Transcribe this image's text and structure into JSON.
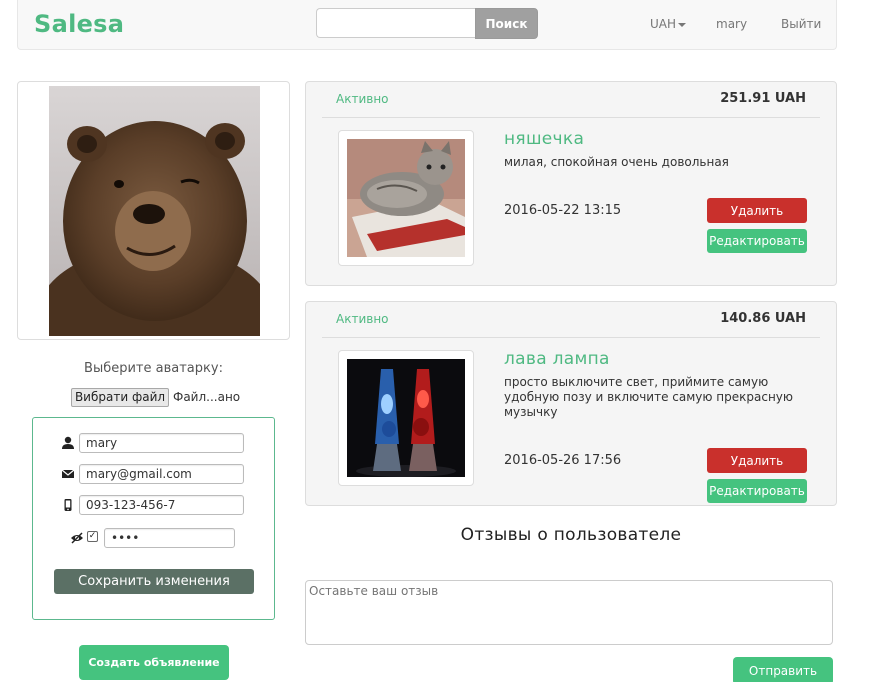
{
  "navbar": {
    "brand": "Salesa",
    "search_placeholder": "",
    "search_button": "Поиск",
    "currency": "UAH",
    "user": "mary",
    "logout": "Выйти"
  },
  "profile": {
    "avatar_label": "Выберите аватарку:",
    "file_button": "Вибрати файл",
    "file_name": "Файл...ано",
    "username": "mary",
    "email": "mary@gmail.com",
    "phone": "093-123-456-7",
    "password": "••••",
    "save_button": "Сохранить изменения",
    "create_button": "Создать объявление"
  },
  "listings": [
    {
      "status": "Активно",
      "price": "251.91 UAH",
      "title": "няшечка",
      "description": "милая, спокойная очень довольная",
      "date": "2016-05-22 13:15",
      "delete_label": "Удалить",
      "edit_label": "Редактировать"
    },
    {
      "status": "Активно",
      "price": "140.86 UAH",
      "title": "лава лампа",
      "description": "просто выключите свет, приймите самую удобную позу и включите самую прекрасную музычку",
      "date": "2016-05-26 17:56",
      "delete_label": "Удалить",
      "edit_label": "Редактировать"
    }
  ],
  "reviews": {
    "title": "Отзывы о пользователе",
    "placeholder": "Оставьте ваш отзыв",
    "send_button": "Отправить"
  },
  "colors": {
    "brand_green": "#4fb982",
    "button_green": "#45c37f",
    "danger_red": "#c9302c",
    "save_gray": "#5b7065"
  }
}
